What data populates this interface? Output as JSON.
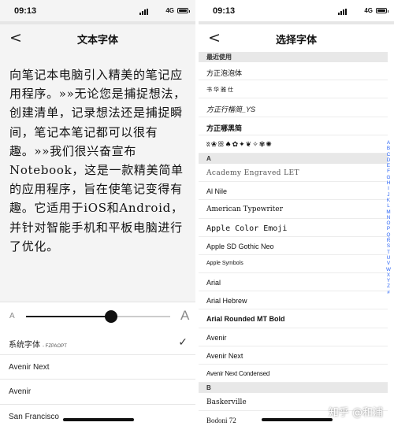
{
  "left": {
    "time": "09:13",
    "network": "4G",
    "back_glyph": "<",
    "title": "文本字体",
    "body_text": "向笔记本电脑引入精美的笔记应用程序。»»无论您是捕捉想法，创建清单，记录想法还是捕捉瞬间，笔记本笔记都可以很有趣。»»我们很兴奋宣布Notebook，这是一款精美简单的应用程序，旨在使笔记变得有趣。它适用于iOS和Android，并针对智能手机和平板电脑进行了优化。",
    "slider": {
      "min_label": "A",
      "max_label": "A",
      "value": 0.59
    },
    "font_options": [
      {
        "name": "系统字体",
        "sub": "- FZPAOPT",
        "selected": true
      },
      {
        "name": "Avenir Next",
        "sub": "",
        "selected": false
      },
      {
        "name": "Avenir",
        "sub": "",
        "selected": false
      },
      {
        "name": "San Francisco",
        "sub": "",
        "selected": false
      }
    ],
    "check_glyph": "✓"
  },
  "right": {
    "time": "09:13",
    "network": "4G",
    "back_glyph": "<",
    "title": "选择字体",
    "recent_header": "最近使用",
    "recent": [
      "方正泡泡体",
      "书华雅仕",
      "方正行楷简_YS",
      "方正哪黑简",
      "ʬ❀ꕥ♠✿✦❦✧✾✺"
    ],
    "section_a": "A",
    "fonts_a": [
      "Academy Engraved LET",
      "Al Nile",
      "American Typewriter",
      "Apple  Color  Emoji",
      "Apple SD Gothic Neo",
      "Apple Symbols",
      "Arial",
      "Arial Hebrew",
      "Arial Rounded MT Bold",
      "Avenir",
      "Avenir Next",
      "Avenir Next Condensed"
    ],
    "section_b": "B",
    "fonts_b": [
      "Baskerville",
      "Bodoni 72"
    ],
    "index_letters": [
      "A",
      "B",
      "C",
      "D",
      "E",
      "F",
      "G",
      "H",
      "I",
      "J",
      "K",
      "L",
      "M",
      "N",
      "O",
      "P",
      "Q",
      "R",
      "S",
      "T",
      "U",
      "V",
      "W",
      "X",
      "Y",
      "Z",
      "#"
    ],
    "index_color": "#2a64f6"
  },
  "watermark": "知乎 @和浦"
}
